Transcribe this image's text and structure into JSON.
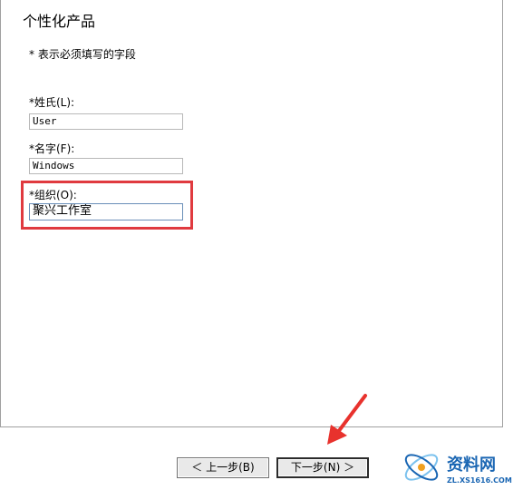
{
  "page": {
    "title": "个性化产品",
    "required_note": "* 表示必须填写的字段"
  },
  "fields": {
    "last_name": {
      "label": "*姓氏(L):",
      "value": "User"
    },
    "first_name": {
      "label": "*名字(F):",
      "value": "Windows"
    },
    "organization": {
      "label": "*组织(O):",
      "value": "聚兴工作室"
    }
  },
  "buttons": {
    "back": "＜ 上一步(B)",
    "next": "下一步(N) ＞"
  },
  "watermark": {
    "brand": "资料网",
    "url": "ZL.XS1616.COM"
  },
  "colors": {
    "highlight": "#e03a3f",
    "arrow": "#e8322d",
    "logo_blue": "#1a66b3"
  }
}
